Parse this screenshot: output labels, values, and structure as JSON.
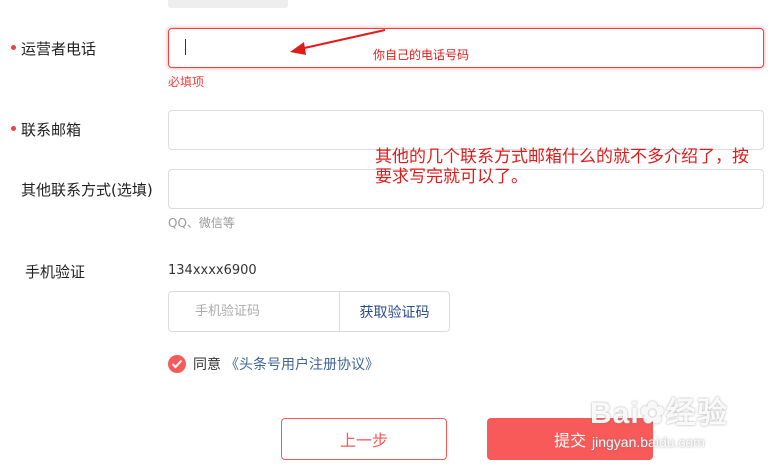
{
  "form": {
    "operator_phone": {
      "label": "运营者电话",
      "value": "",
      "error": "必填项"
    },
    "email": {
      "label": "联系邮箱",
      "value": ""
    },
    "other_contact": {
      "label": "其他联系方式(选填)",
      "value": "",
      "hint": "QQ、微信等"
    },
    "phone_verify": {
      "label": "手机验证",
      "phone": "134xxxx6900",
      "code_placeholder": "手机验证码",
      "get_code_label": "获取验证码"
    },
    "agreement": {
      "prefix": "同意",
      "link_text": "《头条号用户注册协议》",
      "checked": true
    },
    "buttons": {
      "prev": "上一步",
      "submit": "提交"
    }
  },
  "annotations": {
    "phone_note": "你自己的电话号码",
    "other_note": "其他的几个联系方式邮箱什么的就不多介绍了，按要求写完就可以了。"
  },
  "watermark": {
    "logo": "Bai",
    "logo_suffix": "经验",
    "sub": "jingyan.baidu.com"
  },
  "colors": {
    "accent": "#f85959",
    "error": "#f04142",
    "annotation": "#e01b1b",
    "link": "#406599"
  }
}
